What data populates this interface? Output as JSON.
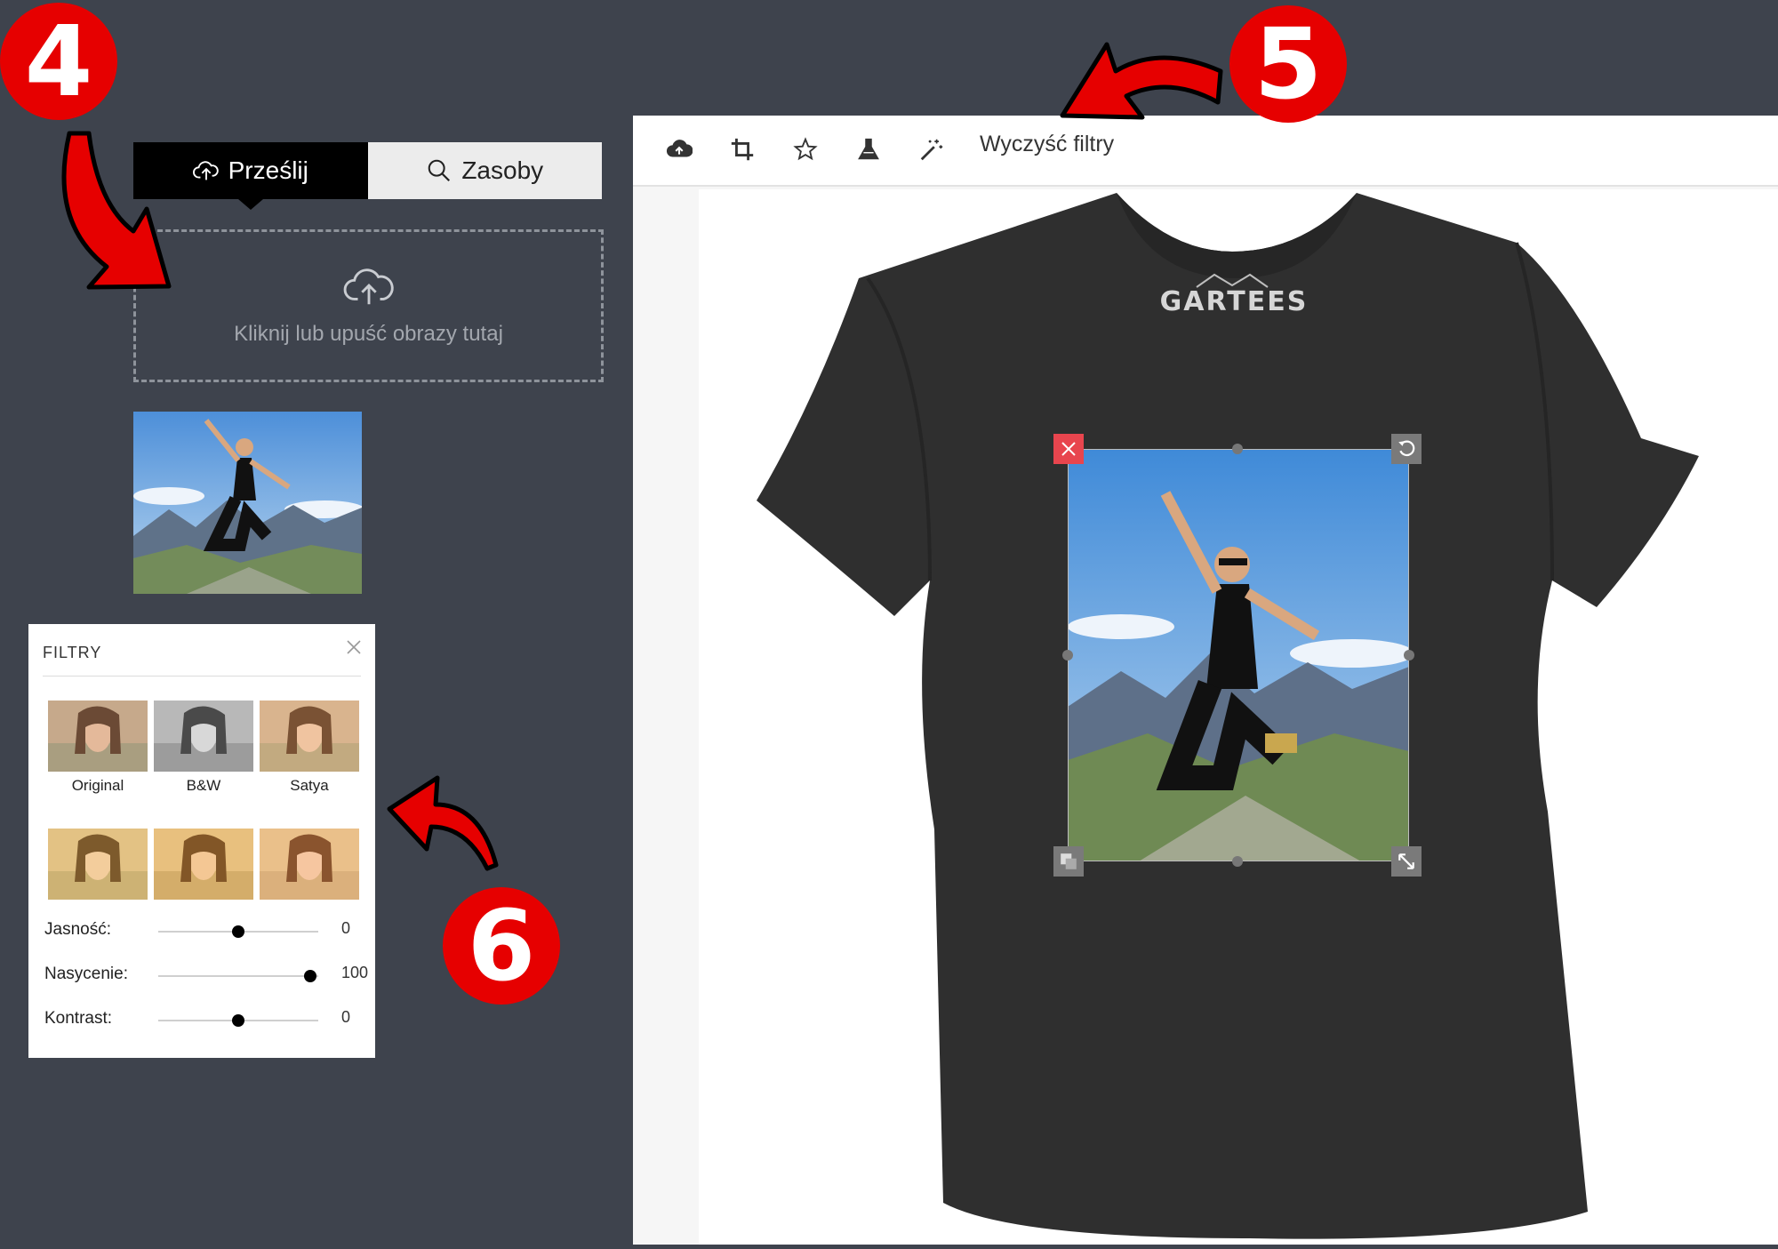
{
  "markers": {
    "four": "4",
    "five": "5",
    "six": "6"
  },
  "upload_panel": {
    "tabs": [
      {
        "label": "Prześlij",
        "icon": "cloud-upload-icon",
        "active": true
      },
      {
        "label": "Zasoby",
        "icon": "search-icon",
        "active": false
      }
    ],
    "dropzone_text": "Kliknij lub upuść obrazy tutaj"
  },
  "filters_panel": {
    "title": "FILTRY",
    "presets": [
      "Original",
      "B&W",
      "Satya"
    ],
    "sliders": [
      {
        "label": "Jasność:",
        "value": "0",
        "level": 0.5
      },
      {
        "label": "Nasycenie:",
        "value": "100",
        "level": 0.95
      },
      {
        "label": "Kontrast:",
        "value": "0",
        "level": 0.5
      }
    ]
  },
  "editor": {
    "toolbar": {
      "icons": [
        "cloud-upload-icon",
        "crop-icon",
        "star-icon",
        "flask-icon",
        "magic-wand-icon"
      ],
      "clear_filters": "Wyczyść filtry"
    },
    "shirt_brand": "GARTEES"
  },
  "colors": {
    "accent_red": "#e60000",
    "panel_bg": "#3e434d",
    "handle_delete": "#e8454e"
  }
}
